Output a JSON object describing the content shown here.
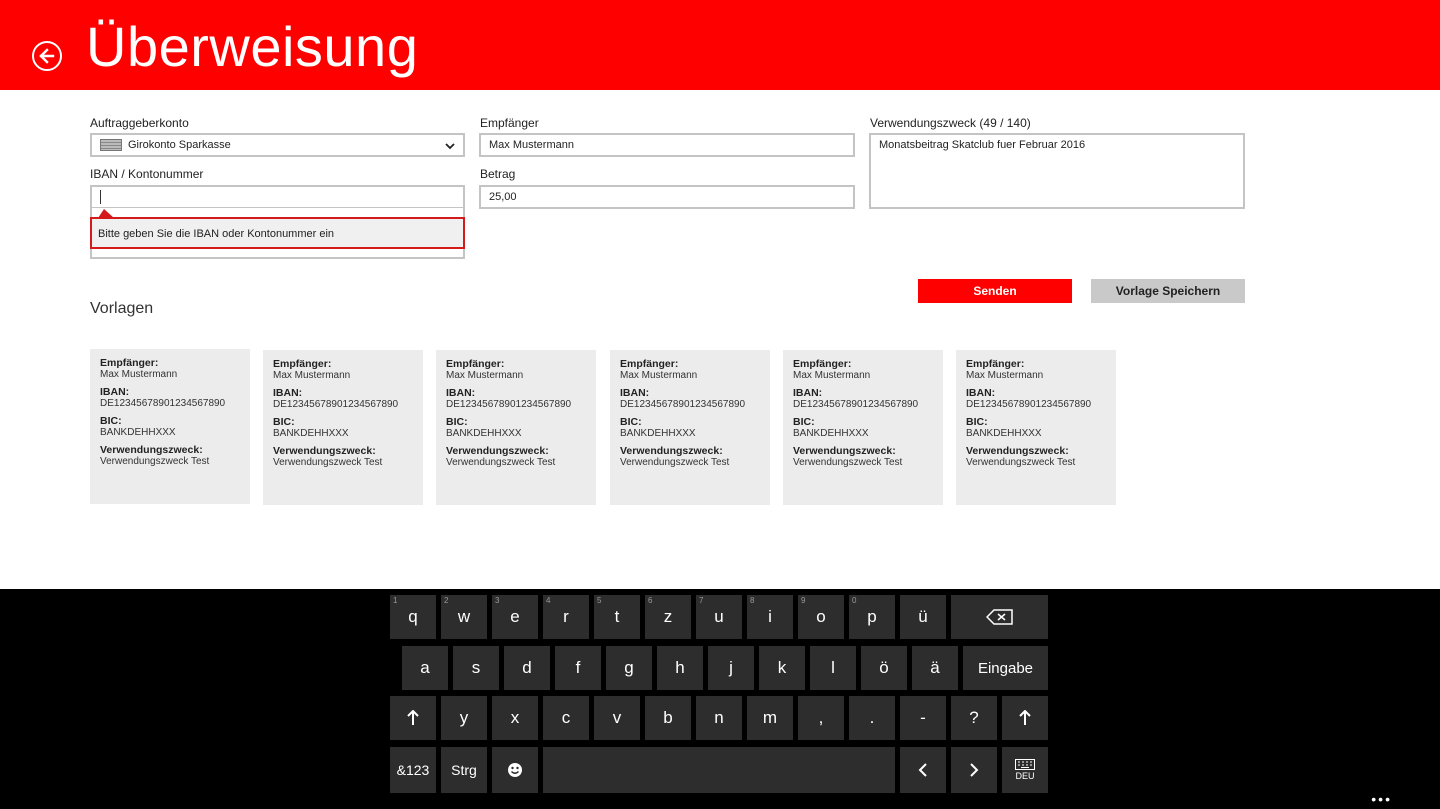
{
  "header": {
    "title": "Überweisung"
  },
  "form": {
    "account_label": "Auftraggeberkonto",
    "account_value": "Girokonto Sparkasse",
    "iban_label": "IBAN / Kontonummer",
    "iban_value": "",
    "iban_error": "Bitte geben Sie die IBAN oder Kontonummer ein",
    "recipient_label": "Empfänger",
    "recipient_value": "Max Mustermann",
    "amount_label": "Betrag",
    "amount_value": "25,00",
    "purpose_label": "Verwendungszweck (49 / 140)",
    "purpose_value": "Monatsbeitrag Skatclub fuer Februar 2016",
    "send_label": "Senden",
    "save_template_label": "Vorlage Speichern"
  },
  "templates": {
    "title": "Vorlagen",
    "items": [
      {
        "recipient_key": "Empfänger:",
        "recipient": "Max Mustermann",
        "iban_key": "IBAN:",
        "iban": "DE12345678901234567890",
        "bic_key": "BIC:",
        "bic": "BANKDEHHXXX",
        "purpose_key": "Verwendungszweck:",
        "purpose": "Verwendungszweck Test"
      },
      {
        "recipient_key": "Empfänger:",
        "recipient": "Max Mustermann",
        "iban_key": "IBAN:",
        "iban": "DE12345678901234567890",
        "bic_key": "BIC:",
        "bic": "BANKDEHHXXX",
        "purpose_key": "Verwendungszweck:",
        "purpose": "Verwendungszweck Test"
      },
      {
        "recipient_key": "Empfänger:",
        "recipient": "Max Mustermann",
        "iban_key": "IBAN:",
        "iban": "DE12345678901234567890",
        "bic_key": "BIC:",
        "bic": "BANKDEHHXXX",
        "purpose_key": "Verwendungszweck:",
        "purpose": "Verwendungszweck Test"
      },
      {
        "recipient_key": "Empfänger:",
        "recipient": "Max Mustermann",
        "iban_key": "IBAN:",
        "iban": "DE12345678901234567890",
        "bic_key": "BIC:",
        "bic": "BANKDEHHXXX",
        "purpose_key": "Verwendungszweck:",
        "purpose": "Verwendungszweck Test"
      },
      {
        "recipient_key": "Empfänger:",
        "recipient": "Max Mustermann",
        "iban_key": "IBAN:",
        "iban": "DE12345678901234567890",
        "bic_key": "BIC:",
        "bic": "BANKDEHHXXX",
        "purpose_key": "Verwendungszweck:",
        "purpose": "Verwendungszweck Test"
      },
      {
        "recipient_key": "Empfänger:",
        "recipient": "Max Mustermann",
        "iban_key": "IBAN:",
        "iban": "DE12345678901234567890",
        "bic_key": "BIC:",
        "bic": "BANKDEHHXXX",
        "purpose_key": "Verwendungszweck:",
        "purpose": "Verwendungszweck Test"
      }
    ]
  },
  "keyboard": {
    "row1": [
      {
        "label": "q",
        "hint": "1"
      },
      {
        "label": "w",
        "hint": "2"
      },
      {
        "label": "e",
        "hint": "3"
      },
      {
        "label": "r",
        "hint": "4"
      },
      {
        "label": "t",
        "hint": "5"
      },
      {
        "label": "z",
        "hint": "6"
      },
      {
        "label": "u",
        "hint": "7"
      },
      {
        "label": "i",
        "hint": "8"
      },
      {
        "label": "o",
        "hint": "9"
      },
      {
        "label": "p",
        "hint": "0"
      },
      {
        "label": "ü",
        "hint": ""
      }
    ],
    "row2": [
      "a",
      "s",
      "d",
      "f",
      "g",
      "h",
      "j",
      "k",
      "l",
      "ö",
      "ä"
    ],
    "row3": [
      "y",
      "x",
      "c",
      "v",
      "b",
      "n",
      "m",
      ",",
      ".",
      "-",
      "?"
    ],
    "enter_label": "Eingabe",
    "symbols_label": "&123",
    "ctrl_label": "Strg",
    "emoji_icon": "emoji-icon",
    "backspace_icon": "backspace-icon",
    "shift_icon": "shift-icon",
    "lang_label": "DEU",
    "more_label": "•••"
  },
  "colors": {
    "brand": "#fe0000",
    "error": "#d41a1a",
    "key_bg": "#2d2d2d"
  }
}
